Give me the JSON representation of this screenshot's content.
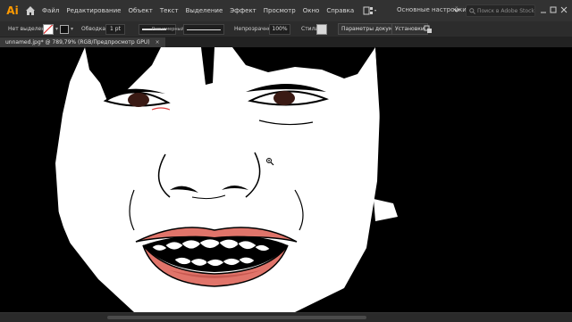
{
  "app": {
    "logo_text": "Ai"
  },
  "menu": {
    "items": [
      "Файл",
      "Редактирование",
      "Объект",
      "Текст",
      "Выделение",
      "Эффект",
      "Просмотр",
      "Окно",
      "Справка"
    ]
  },
  "workspace": {
    "label": "Основные настройки"
  },
  "search": {
    "placeholder": "Поиск в Adobe Stock"
  },
  "control_bar": {
    "selection_label": "Нет выделения",
    "stroke_label": "Обводка:",
    "stroke_weight": "1 pt",
    "stroke_profile_label": "Равномерный",
    "opacity_label": "Непрозрачность:",
    "opacity_value": "100%",
    "style_label": "Стили:",
    "doc_settings_button": "Параметры документа",
    "prefs_button": "Установки"
  },
  "document": {
    "tab_title": "unnamed.jpg* @ 789,79% (RGB/Предпросмотр GPU)",
    "close_glyph": "×"
  },
  "colors": {
    "accent": "#ff9a00",
    "lip": "#e0746a",
    "lip_dark": "#c85a52",
    "iris": "#3a1a14"
  },
  "icons": [
    "home-icon",
    "layout-icon",
    "search-icon",
    "chevron-down-icon",
    "minimize-icon",
    "maximize-icon",
    "close-icon",
    "zoom-cursor-icon"
  ]
}
